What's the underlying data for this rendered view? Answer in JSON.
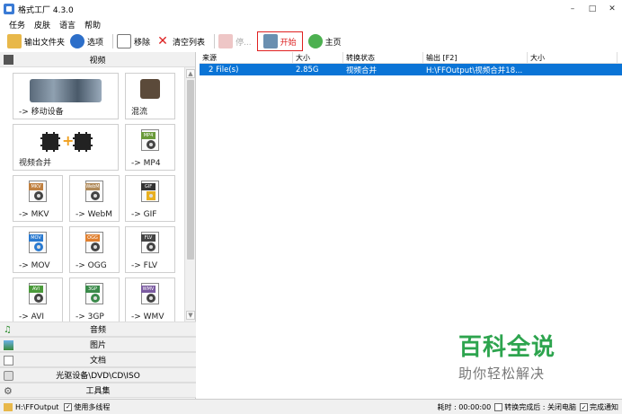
{
  "window": {
    "title": "格式工厂 4.3.0",
    "minimize": "–",
    "maximize": "□",
    "close": "✕"
  },
  "menu": [
    "任务",
    "皮肤",
    "语言",
    "帮助"
  ],
  "toolbar": {
    "output_folder": "输出文件夹",
    "options": "选项",
    "remove": "移除",
    "clear_list": "清空列表",
    "stop": "停...",
    "start": "开始",
    "home": "主页"
  },
  "left_panel": {
    "video_category": "视频",
    "tiles": {
      "mobile": "-> 移动设备",
      "mix": "混流",
      "merge": "视频合并",
      "mp4": "-> MP4",
      "mkv": "-> MKV",
      "webm": "-> WebM",
      "gif": "-> GIF",
      "mov": "-> MOV",
      "ogg": "-> OGG",
      "flv": "-> FLV",
      "avi": "-> AVI",
      "3gp": "-> 3GP",
      "wmv": "-> WMV"
    },
    "badges": {
      "mp4": "MP4",
      "mkv": "MKV",
      "webm": "WebM",
      "gif": "GIF",
      "mov": "MOV",
      "ogg": "OGG",
      "flv": "FLV",
      "avi": "AVI",
      "3gp": "3GP",
      "wmv": "WMV"
    },
    "other_categories": [
      "音频",
      "图片",
      "文档",
      "光驱设备\\DVD\\CD\\ISO",
      "工具集"
    ]
  },
  "table": {
    "headers": [
      "来源",
      "大小",
      "转换状态",
      "输出 [F2]",
      "大小"
    ],
    "rows": [
      [
        "2 File(s)",
        "2.85G",
        "视频合并",
        "H:\\FFOutput\\视频合并18...",
        ""
      ]
    ]
  },
  "watermark": {
    "title": "百科全说",
    "subtitle": "助你轻松解决"
  },
  "statusbar": {
    "output_path": "H:\\FFOutput",
    "multithread": "使用多线程",
    "elapsed": "耗时 : 00:00:00",
    "after_done": "转换完成后 : 关闭电脑",
    "notify": "完成通知"
  },
  "colors": {
    "selection": "#0a74d6",
    "accent_red": "#e02020",
    "watermark_green": "#2da44e"
  }
}
